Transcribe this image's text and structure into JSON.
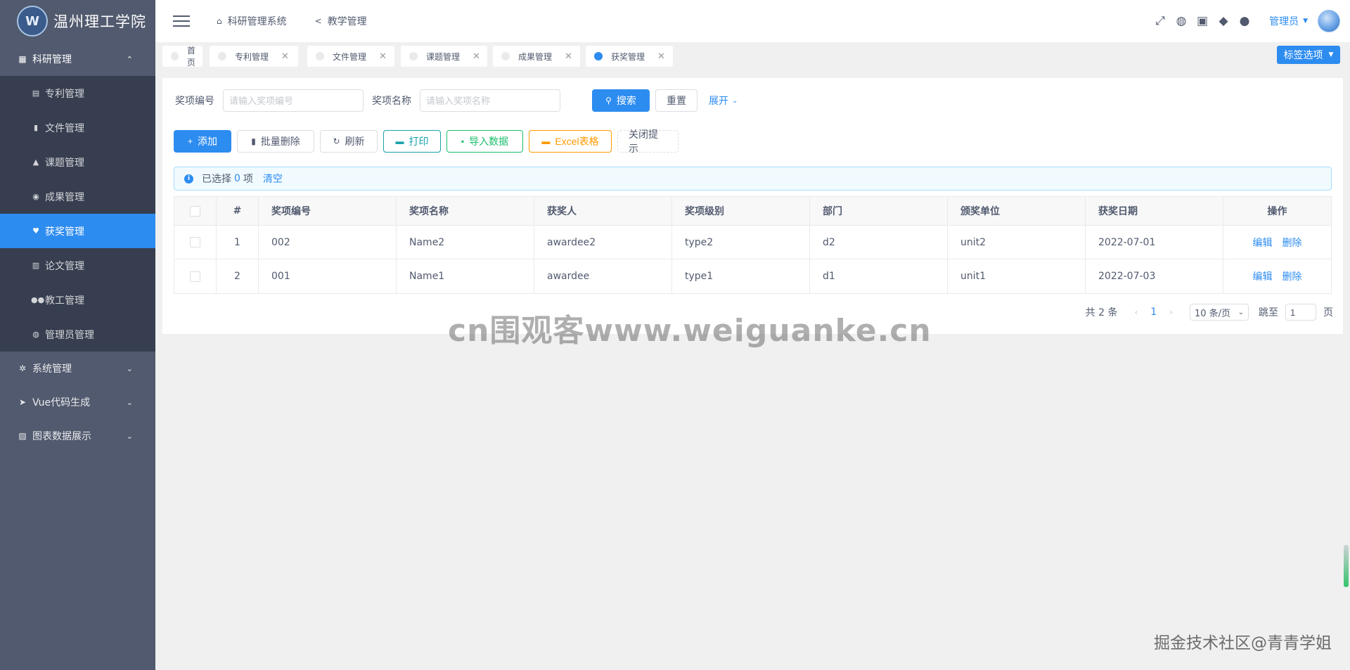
{
  "app": {
    "logo_text": "温州理工学院",
    "logo_glyph": "W"
  },
  "sidebar": {
    "group_research": {
      "label": "科研管理",
      "icon": "grid-icon",
      "chevron": "⌃"
    },
    "items": [
      {
        "label": "专利管理",
        "icon": "document-icon"
      },
      {
        "label": "文件管理",
        "icon": "file-icon"
      },
      {
        "label": "课题管理",
        "icon": "flask-icon"
      },
      {
        "label": "成果管理",
        "icon": "result-icon"
      },
      {
        "label": "获奖管理",
        "icon": "trophy-icon",
        "active": true
      },
      {
        "label": "论文管理",
        "icon": "book-icon"
      },
      {
        "label": "教工管理",
        "icon": "people-icon"
      },
      {
        "label": "管理员管理",
        "icon": "admin-icon"
      }
    ],
    "group_system": {
      "label": "系统管理",
      "icon": "gear-icon"
    },
    "group_vue": {
      "label": "Vue代码生成",
      "icon": "send-icon"
    },
    "group_chart": {
      "label": "图表数据展示",
      "icon": "chart-icon"
    }
  },
  "header": {
    "nav1": "科研管理系统",
    "nav2": "教学管理",
    "user": "管理员"
  },
  "tags": {
    "items": [
      "首页",
      "专利管理",
      "文件管理",
      "课题管理",
      "成果管理",
      "获奖管理"
    ],
    "options_label": "标签选项"
  },
  "search": {
    "label_no": "奖项编号",
    "placeholder_no": "请输入奖项编号",
    "label_name": "奖项名称",
    "placeholder_name": "请输入奖项名称",
    "search_btn": "搜索",
    "reset_btn": "重置",
    "expand": "展开"
  },
  "toolbar": {
    "add": "添加",
    "batch_delete": "批量删除",
    "refresh": "刷新",
    "print": "打印",
    "import": "导入数据",
    "excel": "Excel表格",
    "close_tip": "关闭提示"
  },
  "alert": {
    "prefix": "已选择",
    "count": "0",
    "suffix": "项",
    "clear": "清空"
  },
  "table": {
    "headers": [
      "#",
      "奖项编号",
      "奖项名称",
      "获奖人",
      "奖项级别",
      "部门",
      "颁奖单位",
      "获奖日期",
      "操作"
    ],
    "rows": [
      {
        "idx": "1",
        "no": "002",
        "name": "Name2",
        "awardee": "awardee2",
        "level": "type2",
        "dept": "d2",
        "unit": "unit2",
        "date": "2022-07-01"
      },
      {
        "idx": "2",
        "no": "001",
        "name": "Name1",
        "awardee": "awardee",
        "level": "type1",
        "dept": "d1",
        "unit": "unit1",
        "date": "2022-07-03"
      }
    ],
    "edit": "编辑",
    "delete": "删除"
  },
  "pager": {
    "total": "共 2 条",
    "page": "1",
    "size": "10 条/页",
    "jump": "跳至",
    "jump_value": "1",
    "page_suffix": "页"
  },
  "overlay": {
    "watermark": "cn围观客www.weiguanke.cn",
    "credit": "掘金技术社区@青青学姐"
  },
  "colors": {
    "primary": "#2d8cf0",
    "sidebar": "#515a6e",
    "submenu": "#363e4f"
  }
}
